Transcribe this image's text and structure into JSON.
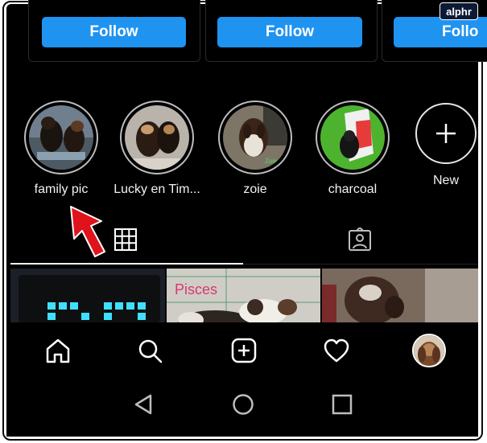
{
  "watermark": "alphr",
  "suggestions": [
    {
      "button": "Follow"
    },
    {
      "button": "Follow"
    },
    {
      "button": "Follo"
    }
  ],
  "highlights": [
    {
      "label": "family pic"
    },
    {
      "label": "Lucky en Tim..."
    },
    {
      "label": "zoie"
    },
    {
      "label": "charcoal"
    }
  ],
  "new_highlight": {
    "label": "New"
  },
  "tabs": [
    {
      "icon": "grid-icon",
      "selected": true
    },
    {
      "icon": "tagged-icon",
      "selected": false
    }
  ],
  "posts": [
    {
      "caption": ""
    },
    {
      "caption": "Pisces"
    },
    {
      "caption": ""
    }
  ],
  "nav": [
    "home-icon",
    "search-icon",
    "new-post-icon",
    "activity-icon",
    "profile-avatar"
  ],
  "system_nav": [
    "back-icon",
    "home-circle-icon",
    "recents-icon"
  ],
  "colors": {
    "accent": "#1f93f0",
    "background": "#000000",
    "annotation_arrow": "#e0121b"
  }
}
